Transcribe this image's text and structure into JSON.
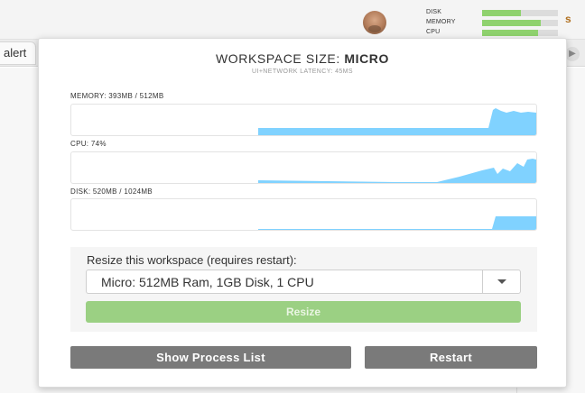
{
  "background_tab": {
    "label": "alert"
  },
  "header_right_label": "s",
  "avatar": {
    "alt": "user-avatar"
  },
  "status_meters": [
    {
      "label": "DISK",
      "fill": 0.51
    },
    {
      "label": "MEMORY",
      "fill": 0.77
    },
    {
      "label": "CPU",
      "fill": 0.74
    }
  ],
  "popup": {
    "title_prefix": "WORKSPACE SIZE: ",
    "title_value": "MICRO",
    "subtitle": "UI+NETWORK LATENCY: 45MS",
    "graphs": [
      {
        "id": "memory",
        "label": "MEMORY: 393MB / 512MB"
      },
      {
        "id": "cpu",
        "label": "CPU: 74%"
      },
      {
        "id": "disk",
        "label": "DISK: 520MB / 1024MB"
      }
    ],
    "resize": {
      "label": "Resize this workspace (requires restart):",
      "selected": "Micro: 512MB Ram, 1GB Disk, 1 CPU",
      "button": "Resize"
    },
    "show_process_list": "Show Process List",
    "restart": "Restart"
  },
  "colors": {
    "meter_fill": "#8fd26e",
    "graph_fill": "#80d2ff",
    "resize_button": "#9bd083",
    "dark_button": "#7a7a7a"
  }
}
